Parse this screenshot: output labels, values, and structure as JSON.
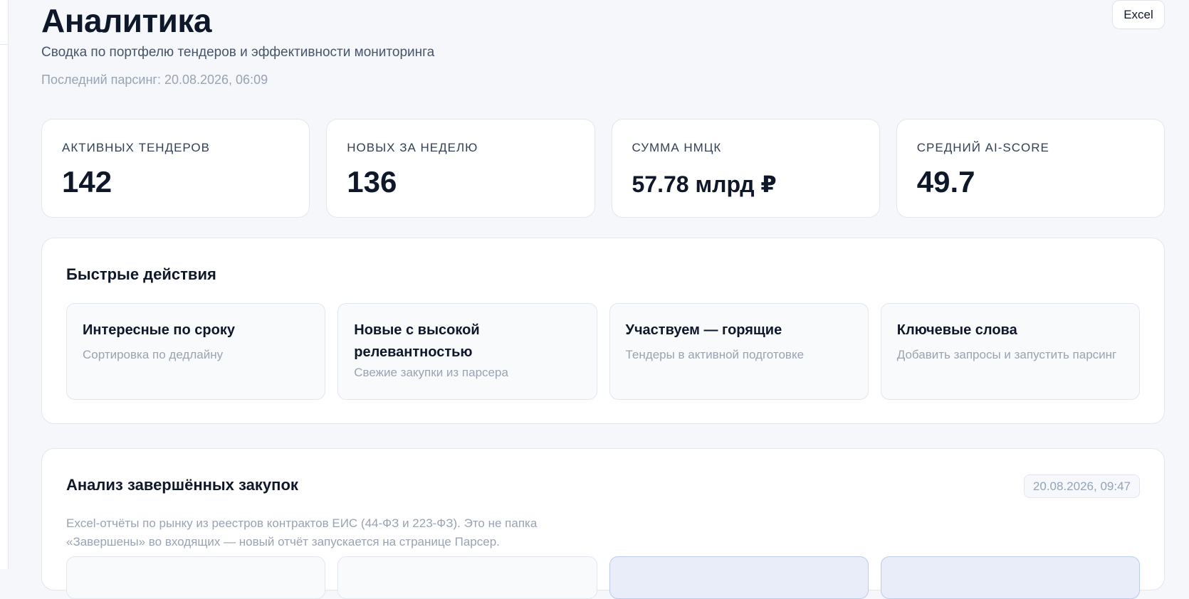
{
  "header": {
    "title": "Аналитика",
    "subtitle": "Сводка по портфелю тендеров и эффективности мониторинга",
    "last_parse": "Последний парсинг: 20.08.2026, 06:09",
    "excel_label": "Excel"
  },
  "stats": [
    {
      "label": "АКТИВНЫХ ТЕНДЕРОВ",
      "value": "142"
    },
    {
      "label": "НОВЫХ ЗА НЕДЕЛЮ",
      "value": "136"
    },
    {
      "label": "СУММА НМЦК",
      "value": "57.78 млрд ₽"
    },
    {
      "label": "СРЕДНИЙ AI-SCORE",
      "value": "49.7"
    }
  ],
  "quick_actions": {
    "title": "Быстрые действия",
    "items": [
      {
        "title": "Интересные по сроку",
        "desc": "Сортировка по дедлайну"
      },
      {
        "title": "Новые с высокой релевантностью",
        "desc": "Свежие закупки из парсера"
      },
      {
        "title": "Участвуем — горящие",
        "desc": "Тендеры в активной подготовке"
      },
      {
        "title": "Ключевые слова",
        "desc": "Добавить запросы и запустить парсинг"
      }
    ]
  },
  "analysis": {
    "title": "Анализ завершённых закупок",
    "date": "20.08.2026, 09:47",
    "desc": "Excel-отчёты по рынку из реестров контрактов ЕИС (44-ФЗ и 223-ФЗ). Это не папка «Завершены» во входящих — новый отчёт запускается на странице Парсер."
  },
  "colors": {
    "background": "#f5f7fa",
    "card": "#ffffff",
    "accent_card": "#e8edf9",
    "muted_text": "#9aa3b2"
  }
}
